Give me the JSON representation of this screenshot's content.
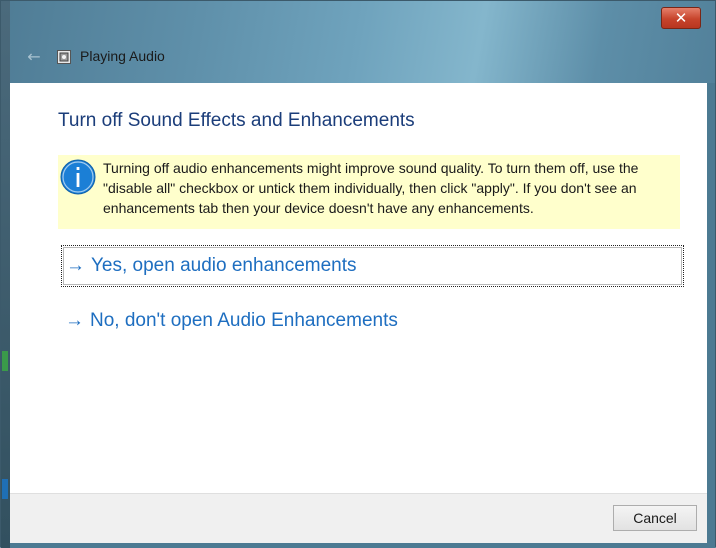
{
  "window": {
    "title": "Playing Audio",
    "close_label": "✕",
    "back_icon": "back-arrow-icon",
    "app_icon": "audio-troubleshooter-icon"
  },
  "content": {
    "heading": "Turn off Sound Effects and Enhancements",
    "info": {
      "icon": "info-icon",
      "text": "Turning off audio enhancements might improve sound quality. To turn them off, use the \"disable all\" checkbox or untick them individually, then click \"apply\". If you don't see an enhancements tab then your device doesn't have any enhancements."
    },
    "options": [
      {
        "arrow": "→",
        "label": "Yes, open audio enhancements",
        "focused": true
      },
      {
        "arrow": "→",
        "label": "No, don't open Audio Enhancements",
        "focused": false
      }
    ]
  },
  "footer": {
    "cancel_label": "Cancel"
  },
  "colors": {
    "heading": "#1b3d7a",
    "link": "#1e6ec0",
    "info_bg": "#ffffcc",
    "info_icon": "#1b7fd6",
    "close_button": "#c7442c"
  }
}
